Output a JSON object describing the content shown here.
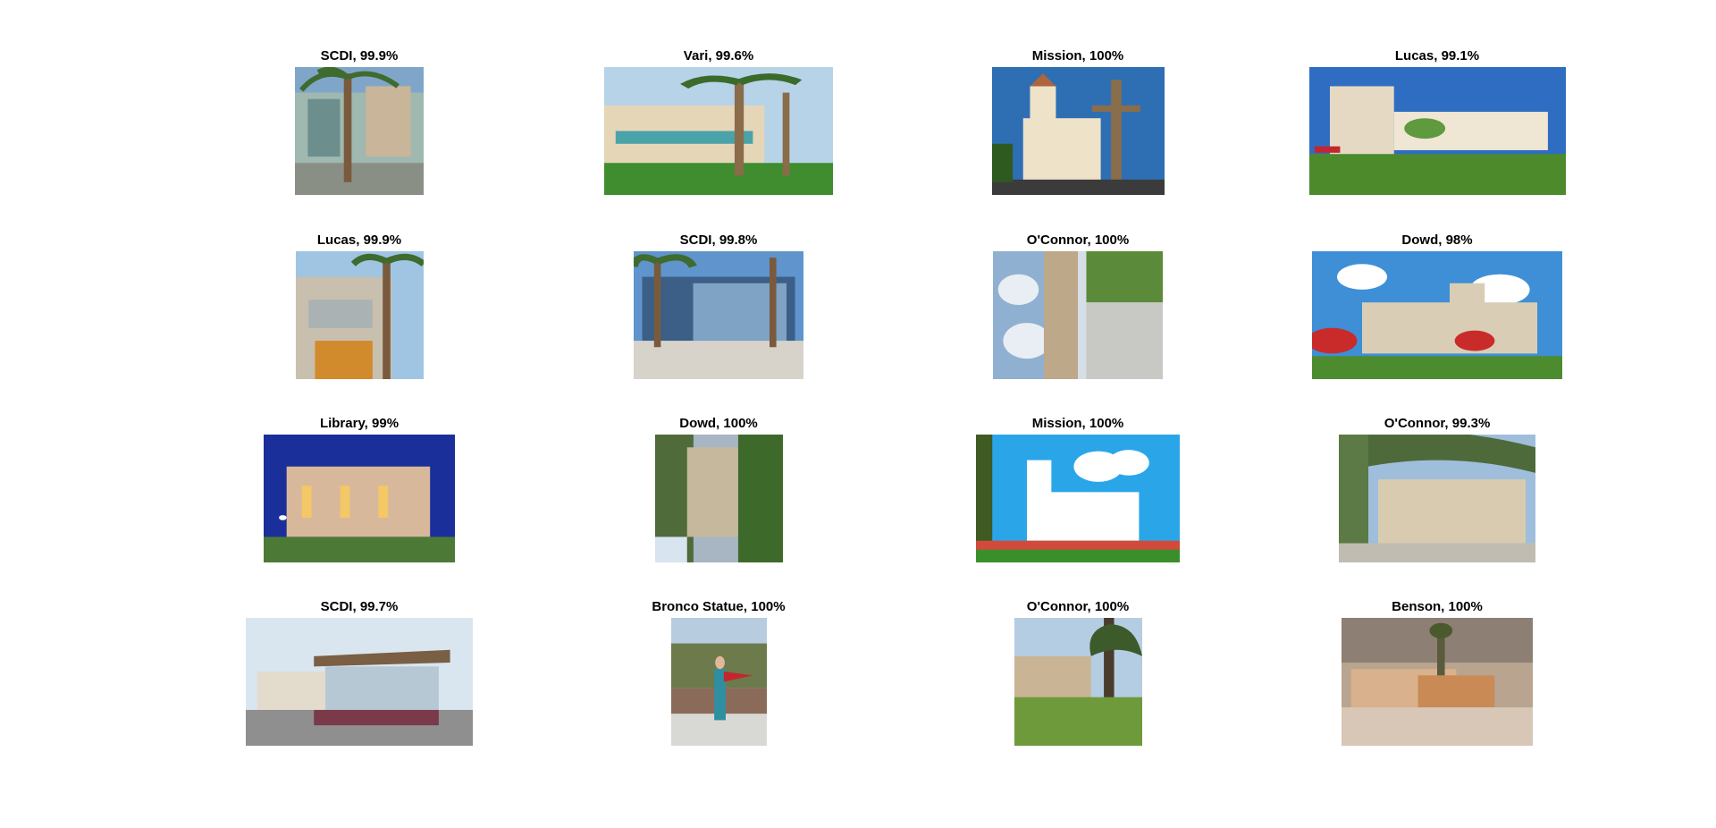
{
  "figure": {
    "images": [
      {
        "title": "SCDI, 99.9%",
        "label": "SCDI",
        "confidence_percent": 99.9,
        "scene": "courtyard-palms"
      },
      {
        "title": "Vari, 99.6%",
        "label": "Vari",
        "confidence_percent": 99.6,
        "scene": "building-palms-wide"
      },
      {
        "title": "Mission, 100%",
        "label": "Mission",
        "confidence_percent": 100,
        "scene": "mission-cross"
      },
      {
        "title": "Lucas, 99.1%",
        "label": "Lucas",
        "confidence_percent": 99.1,
        "scene": "building-lawn"
      },
      {
        "title": "Lucas, 99.9%",
        "label": "Lucas",
        "confidence_percent": 99.9,
        "scene": "entrance-palm"
      },
      {
        "title": "SCDI, 99.8%",
        "label": "SCDI",
        "confidence_percent": 99.8,
        "scene": "glass-building-palms"
      },
      {
        "title": "O'Connor, 100%",
        "label": "O'Connor",
        "confidence_percent": 100,
        "scene": "rotated-building"
      },
      {
        "title": "Dowd, 98%",
        "label": "Dowd",
        "confidence_percent": 98,
        "scene": "rendering-red-trees"
      },
      {
        "title": "Library, 99%",
        "label": "Library",
        "confidence_percent": 99,
        "scene": "night-building"
      },
      {
        "title": "Dowd, 100%",
        "label": "Dowd",
        "confidence_percent": 100,
        "scene": "rotated-dowd"
      },
      {
        "title": "Mission, 100%",
        "label": "Mission",
        "confidence_percent": 100,
        "scene": "mission-garden"
      },
      {
        "title": "O'Connor, 99.3%",
        "label": "O'Connor",
        "confidence_percent": 99.3,
        "scene": "building-trees-arch"
      },
      {
        "title": "SCDI, 99.7%",
        "label": "SCDI",
        "confidence_percent": 99.7,
        "scene": "modern-canopy"
      },
      {
        "title": "Bronco Statue, 100%",
        "label": "Bronco Statue",
        "confidence_percent": 100,
        "scene": "person-pennant"
      },
      {
        "title": "O'Connor, 100%",
        "label": "O'Connor",
        "confidence_percent": 100,
        "scene": "building-grass-tree"
      },
      {
        "title": "Benson, 100%",
        "label": "Benson",
        "confidence_percent": 100,
        "scene": "sepia-steps"
      }
    ]
  }
}
